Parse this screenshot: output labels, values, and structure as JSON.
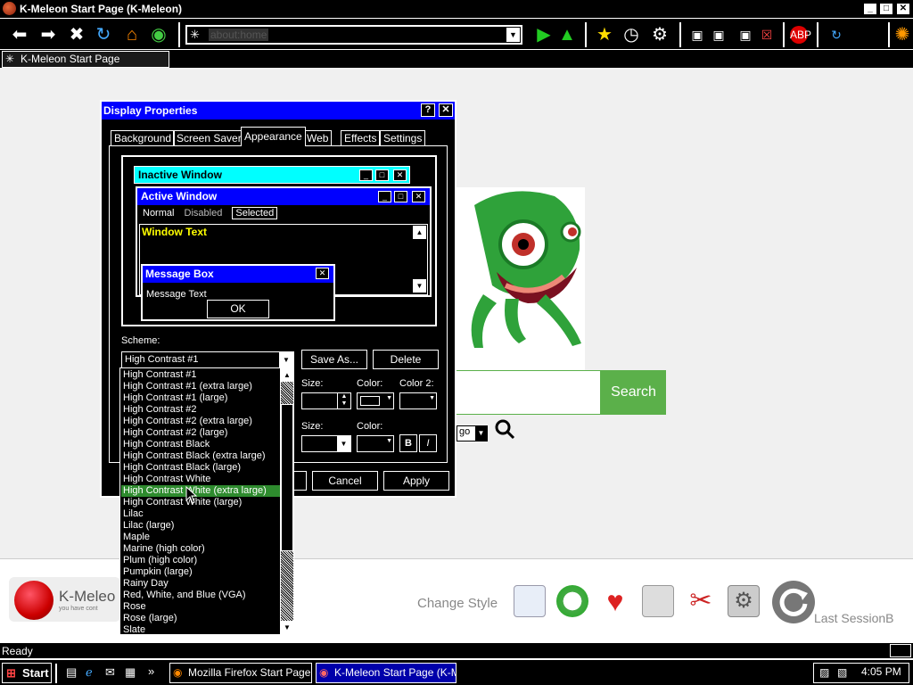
{
  "window": {
    "title": "K-Meleon Start Page (K-Meleon)",
    "min": "_",
    "max": "□",
    "close": "✕"
  },
  "toolbar": {
    "url": "about:home"
  },
  "tabs": [
    {
      "label": "K-Meleon Start Page"
    }
  ],
  "page": {
    "search_button": "Search",
    "engine_value": "go",
    "logo_text": "K-Meleo",
    "logo_sub": "you have cont",
    "change_style": "Change Style",
    "last_session": "Last SessionB"
  },
  "dialog": {
    "title": "Display Properties",
    "help": "?",
    "close": "✕",
    "tabs": [
      "Background",
      "Screen Saver",
      "Appearance",
      "Web",
      "Effects",
      "Settings"
    ],
    "active_tab": "Appearance",
    "preview": {
      "inactive_title": "Inactive Window",
      "active_title": "Active Window",
      "menu_normal": "Normal",
      "menu_disabled": "Disabled",
      "menu_selected": "Selected",
      "window_text": "Window Text",
      "msg_title": "Message Box",
      "msg_text": "Message Text",
      "msg_ok": "OK"
    },
    "scheme_label": "Scheme:",
    "scheme_value": "High Contrast #1",
    "save_as": "Save As...",
    "delete": "Delete",
    "size_label": "Size:",
    "color_label": "Color:",
    "color2_label": "Color 2:",
    "size_label2": "Size:",
    "color_label2": "Color:",
    "bold": "B",
    "italic": "I",
    "cancel": "Cancel",
    "apply": "Apply"
  },
  "scheme_list": [
    "High Contrast #1",
    "High Contrast #1 (extra large)",
    "High Contrast #1 (large)",
    "High Contrast #2",
    "High Contrast #2 (extra large)",
    "High Contrast #2 (large)",
    "High Contrast Black",
    "High Contrast Black (extra large)",
    "High Contrast Black (large)",
    "High Contrast White",
    "High Contrast White (extra large)",
    "High Contrast White (large)",
    "Lilac",
    "Lilac (large)",
    "Maple",
    "Marine (high color)",
    "Plum (high color)",
    "Pumpkin (large)",
    "Rainy Day",
    "Red, White, and Blue (VGA)",
    "Rose",
    "Rose (large)",
    "Slate"
  ],
  "highlighted_scheme_index": 10,
  "status": {
    "text": "Ready"
  },
  "taskbar": {
    "start": "Start",
    "tasks": [
      "Mozilla Firefox Start Page -...",
      "K-Meleon Start Page (K-M..."
    ],
    "clock": "4:05 PM"
  },
  "colors": {
    "dialog_title": "#0000ff",
    "inactive_title": "#00ffff",
    "highlight": "#2e8b2e",
    "search_green": "#5bb04a"
  }
}
